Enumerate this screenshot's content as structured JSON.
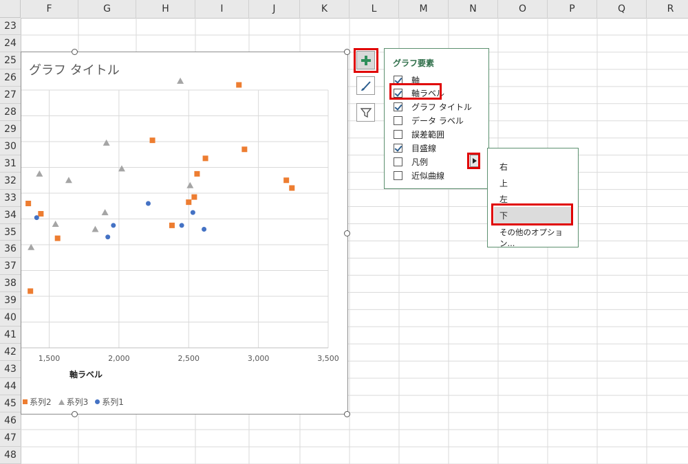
{
  "grid": {
    "columns": [
      "F",
      "G",
      "H",
      "I",
      "J",
      "K",
      "L",
      "M",
      "N",
      "O",
      "P",
      "Q",
      "R"
    ],
    "rows": [
      "23",
      "24",
      "25",
      "26",
      "27",
      "28",
      "29",
      "30",
      "31",
      "32",
      "33",
      "34",
      "35",
      "36",
      "37",
      "38",
      "39",
      "40",
      "41",
      "42",
      "43",
      "44",
      "45",
      "46",
      "47",
      "48"
    ]
  },
  "chart": {
    "title": "グラフ タイトル",
    "xlabel": "軸ラベル",
    "legend": [
      {
        "name": "系列2",
        "color": "#ed7d31",
        "marker": "square"
      },
      {
        "name": "系列3",
        "color": "#a5a5a5",
        "marker": "triangle"
      },
      {
        "name": "系列1",
        "color": "#4472c4",
        "marker": "circle"
      }
    ]
  },
  "chart_data": {
    "type": "scatter",
    "title": "グラフ タイトル",
    "xlabel": "軸ラベル",
    "ylabel": "",
    "xlim": [
      1300,
      3500
    ],
    "xticks": [
      "1,500",
      "2,000",
      "2,500",
      "3,000",
      "3,500"
    ],
    "xtick_values": [
      1500,
      2000,
      2500,
      3000,
      3500
    ],
    "ylim": [
      0,
      20
    ],
    "grid": true,
    "legend_position": "bottom-left",
    "series": [
      {
        "name": "系列2",
        "color": "#ed7d31",
        "marker": "square",
        "points": [
          [
            1350,
            11.2
          ],
          [
            1365,
            4.4
          ],
          [
            1440,
            10.4
          ],
          [
            1560,
            8.5
          ],
          [
            2240,
            16.1
          ],
          [
            2380,
            9.5
          ],
          [
            2500,
            11.3
          ],
          [
            2540,
            11.7
          ],
          [
            2560,
            13.5
          ],
          [
            2620,
            14.7
          ],
          [
            2860,
            20.4
          ],
          [
            2900,
            15.4
          ],
          [
            3200,
            13.0
          ],
          [
            3240,
            12.4
          ]
        ]
      },
      {
        "name": "系列3",
        "color": "#a5a5a5",
        "marker": "triangle",
        "points": [
          [
            1370,
            7.8
          ],
          [
            1430,
            13.5
          ],
          [
            1545,
            9.6
          ],
          [
            1640,
            13.0
          ],
          [
            1830,
            9.2
          ],
          [
            1900,
            10.5
          ],
          [
            1910,
            15.9
          ],
          [
            2020,
            13.9
          ],
          [
            2440,
            20.7
          ],
          [
            2510,
            12.6
          ]
        ]
      },
      {
        "name": "系列1",
        "color": "#4472c4",
        "marker": "circle",
        "points": [
          [
            1410,
            10.1
          ],
          [
            1920,
            8.6
          ],
          [
            1960,
            9.5
          ],
          [
            2210,
            11.2
          ],
          [
            2450,
            9.5
          ],
          [
            2530,
            10.5
          ],
          [
            2610,
            9.2
          ]
        ]
      }
    ]
  },
  "tools": {
    "elements_icon": "plus-icon",
    "styles_icon": "brush-icon",
    "filter_icon": "filter-icon"
  },
  "elements_panel": {
    "title": "グラフ要素",
    "items": [
      {
        "label": "軸",
        "checked": true
      },
      {
        "label": "軸ラベル",
        "checked": true
      },
      {
        "label": "グラフ タイトル",
        "checked": true
      },
      {
        "label": "データ ラベル",
        "checked": false
      },
      {
        "label": "誤差範囲",
        "checked": false
      },
      {
        "label": "目盛線",
        "checked": true
      },
      {
        "label": "凡例",
        "checked": false
      },
      {
        "label": "近似曲線",
        "checked": false
      }
    ]
  },
  "legend_submenu": {
    "items": [
      "右",
      "上",
      "左",
      "下",
      "その他のオプション..."
    ],
    "selected": "下"
  },
  "colors": {
    "highlight": "#e00000",
    "panel_border": "#5b8f6e",
    "panel_title": "#2f6f4a"
  }
}
